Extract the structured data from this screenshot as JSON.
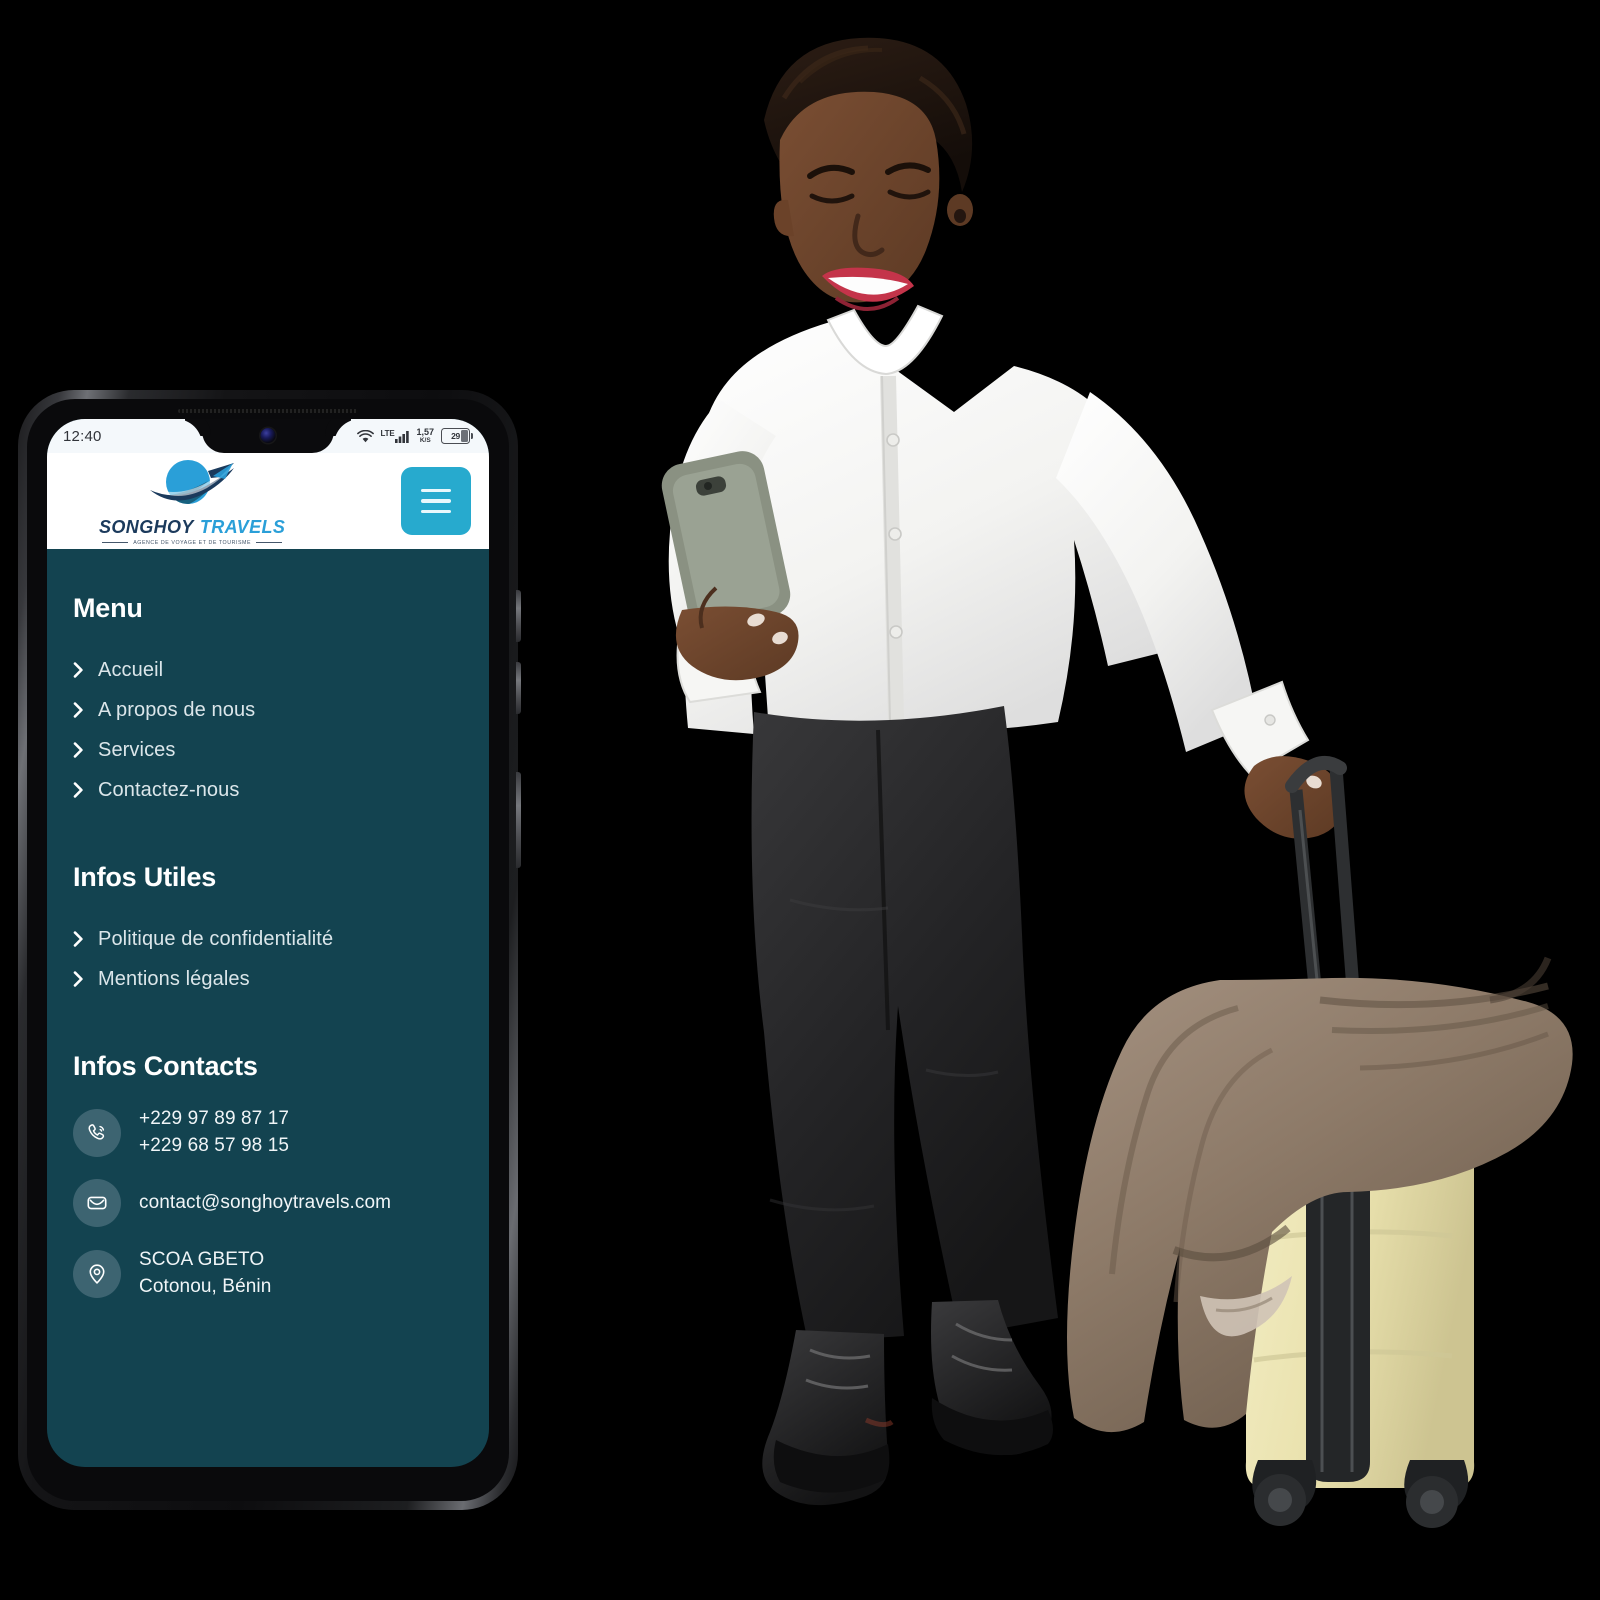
{
  "device": {
    "status_bar": {
      "time": "12:40",
      "wifi_icon": "wifi-icon",
      "network_label": "LTE",
      "signal_icon": "signal-bars-icon",
      "data_rate_value": "1,57",
      "data_rate_unit": "K/S",
      "battery_percent": "29",
      "battery_icon": "battery-icon"
    }
  },
  "app": {
    "header": {
      "logo_icon": "globe-airplane-logo",
      "brand_primary": "SONGHOY",
      "brand_secondary": "TRAVELS",
      "tagline": "AGENCE DE VOYAGE ET DE TOURISME",
      "menu_button_icon": "hamburger-icon",
      "menu_button_label": "Menu"
    },
    "menu_section": {
      "title": "Menu",
      "items": [
        {
          "label": "Accueil",
          "icon": "chevron-right-icon"
        },
        {
          "label": "A propos de nous",
          "icon": "chevron-right-icon"
        },
        {
          "label": "Services",
          "icon": "chevron-right-icon"
        },
        {
          "label": "Contactez-nous",
          "icon": "chevron-right-icon"
        }
      ]
    },
    "useful_info_section": {
      "title": "Infos Utiles",
      "items": [
        {
          "label": "Politique de confidentialité",
          "icon": "chevron-right-icon"
        },
        {
          "label": "Mentions légales",
          "icon": "chevron-right-icon"
        }
      ]
    },
    "contacts_section": {
      "title": "Infos Contacts",
      "rows": [
        {
          "icon": "phone-icon",
          "lines": [
            "+229 97 89 87 17",
            "+229 68 57 98 15"
          ]
        },
        {
          "icon": "envelope-icon",
          "lines": [
            "contact@songhoytravels.com"
          ]
        },
        {
          "icon": "location-pin-icon",
          "lines": [
            "SCOA GBETO",
            "Cotonou, Bénin"
          ]
        }
      ]
    }
  },
  "photo": {
    "subject": "woman-with-phone-and-suitcase",
    "elements": [
      "smiling-woman",
      "white-shirt",
      "black-trousers",
      "black-boots",
      "held-smartphone",
      "cream-suitcase",
      "brown-fur-blanket"
    ]
  },
  "colors": {
    "panel_teal": "#134350",
    "accent_cyan": "#27aace",
    "brand_navy": "#1b3a5c",
    "brand_blue": "#2a9fd8",
    "icon_circle": "#3d6471",
    "page_background": "#000000",
    "status_bar_bg": "#f4f8fb"
  }
}
